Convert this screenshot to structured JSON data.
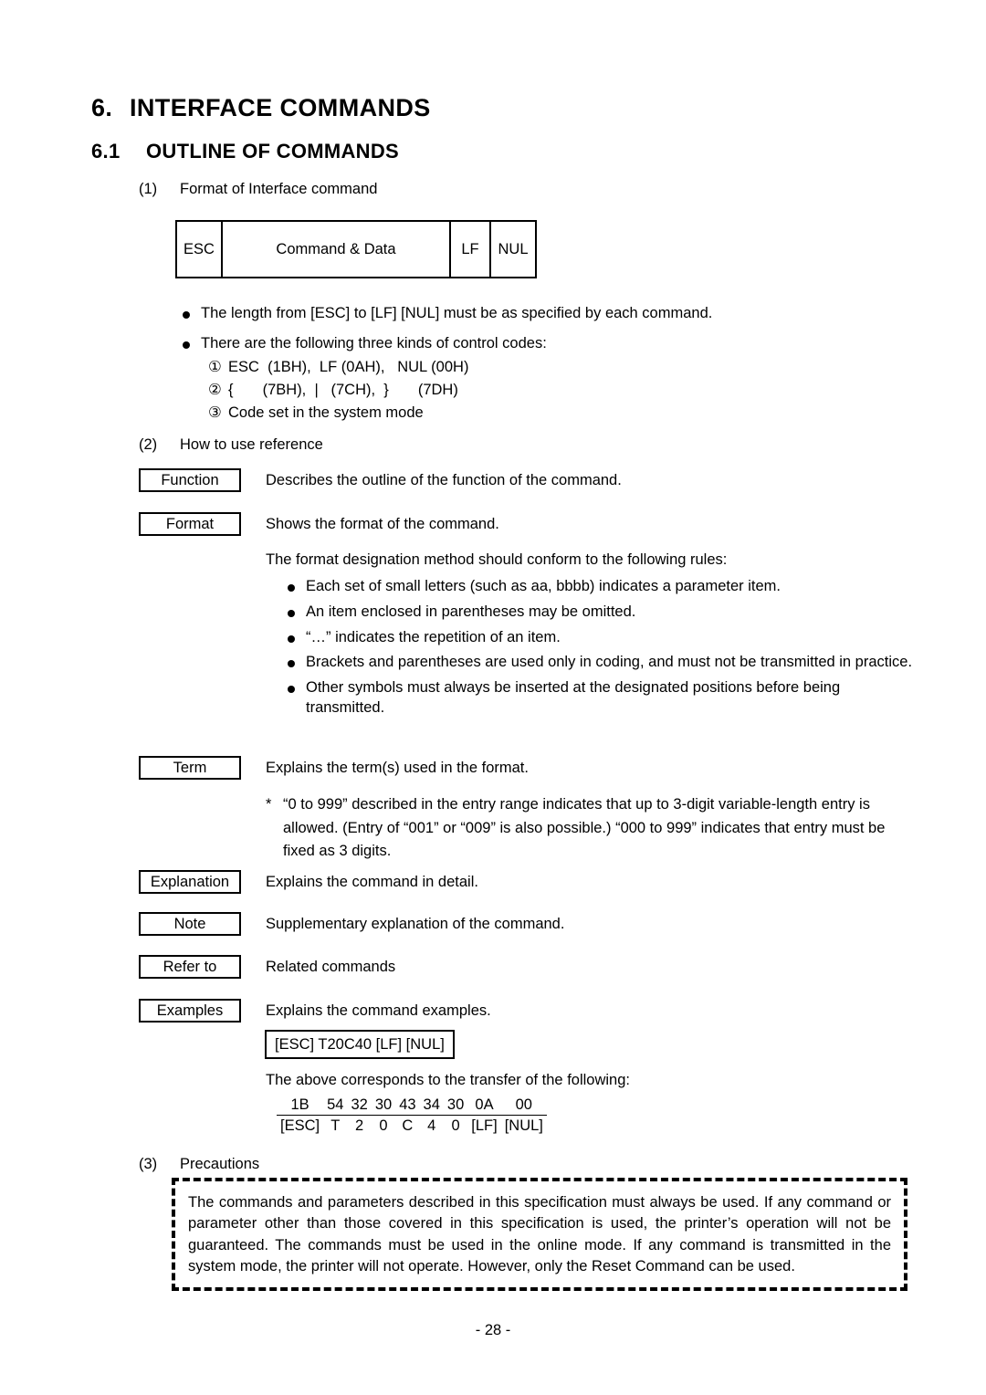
{
  "document": {
    "chapter_number": "6.",
    "chapter_title": "INTERFACE COMMANDS",
    "section_number": "6.1",
    "section_title": "OUTLINE OF COMMANDS",
    "page_footer": "- 28 -"
  },
  "sections": {
    "format": {
      "marker": "(1)",
      "title": "Format of Interface command",
      "table": {
        "esc": "ESC",
        "data": "Command & Data",
        "lf": "LF",
        "nul": "NUL"
      },
      "bullets": [
        "The length from [ESC] to [LF] [NUL] must be as specified by each command.",
        "There are the following three kinds of control codes:"
      ],
      "control_codes": [
        {
          "mark": "①",
          "text": "ESC  (1BH),  LF (0AH),   NUL (00H)"
        },
        {
          "mark": "②",
          "text": "{       (7BH),  |   (7CH),  }       (7DH)"
        },
        {
          "mark": "③",
          "text": "Code set in the system mode"
        }
      ]
    },
    "reference": {
      "marker": "(2)",
      "title": "How to use reference",
      "entries": [
        {
          "label": "Function",
          "description": "Describes the outline of the function of the command."
        },
        {
          "label": "Format",
          "description": "Shows the format of the command."
        },
        {
          "label": "Term",
          "description": "Explains the term(s) used in the format."
        },
        {
          "label": "Explanation",
          "description": "Explains the command in detail."
        },
        {
          "label": "Note",
          "description": "Supplementary explanation of the command."
        },
        {
          "label": "Refer to",
          "description": "Related commands"
        },
        {
          "label": "Examples",
          "description": "Explains the command examples."
        }
      ],
      "format_rules_intro": "The format designation method should conform to the following rules:",
      "format_rules": [
        "Each set of small letters (such as aa, bbbb) indicates a parameter item.",
        "An item enclosed in parentheses may be omitted.",
        "“…” indicates the repetition of an item.",
        "Brackets and parentheses are used only in coding, and must not be transmitted in practice.",
        "Other symbols must always be inserted at the designated positions before being transmitted."
      ],
      "term_note_marker": "*",
      "term_note": "“0 to 999” described in the entry range indicates that up to 3-digit variable-length entry is allowed.  (Entry of “001” or “009” is also possible.)  “000 to 999” indicates that entry must be fixed as 3 digits.",
      "example_command": "[ESC] T20C40 [LF] [NUL]",
      "example_caption": "The above corresponds to the transfer of the following:",
      "transfer_table": {
        "hex": [
          "1B",
          "54",
          "32",
          "30",
          "43",
          "34",
          "30",
          "0A",
          "00"
        ],
        "ascii": [
          "[ESC]",
          "T",
          "2",
          "0",
          "C",
          "4",
          "0",
          "[LF]",
          "[NUL]"
        ]
      }
    },
    "precautions": {
      "marker": "(3)",
      "title": "Precautions",
      "body": "The commands and parameters described in this specification must always be used.  If any command or parameter other than those covered in this specification is used, the printer’s operation will not be guaranteed.  The commands must be used in the online mode.   If any command is transmitted in the system mode, the printer will not operate.  However, only the Reset Command can be used."
    }
  }
}
